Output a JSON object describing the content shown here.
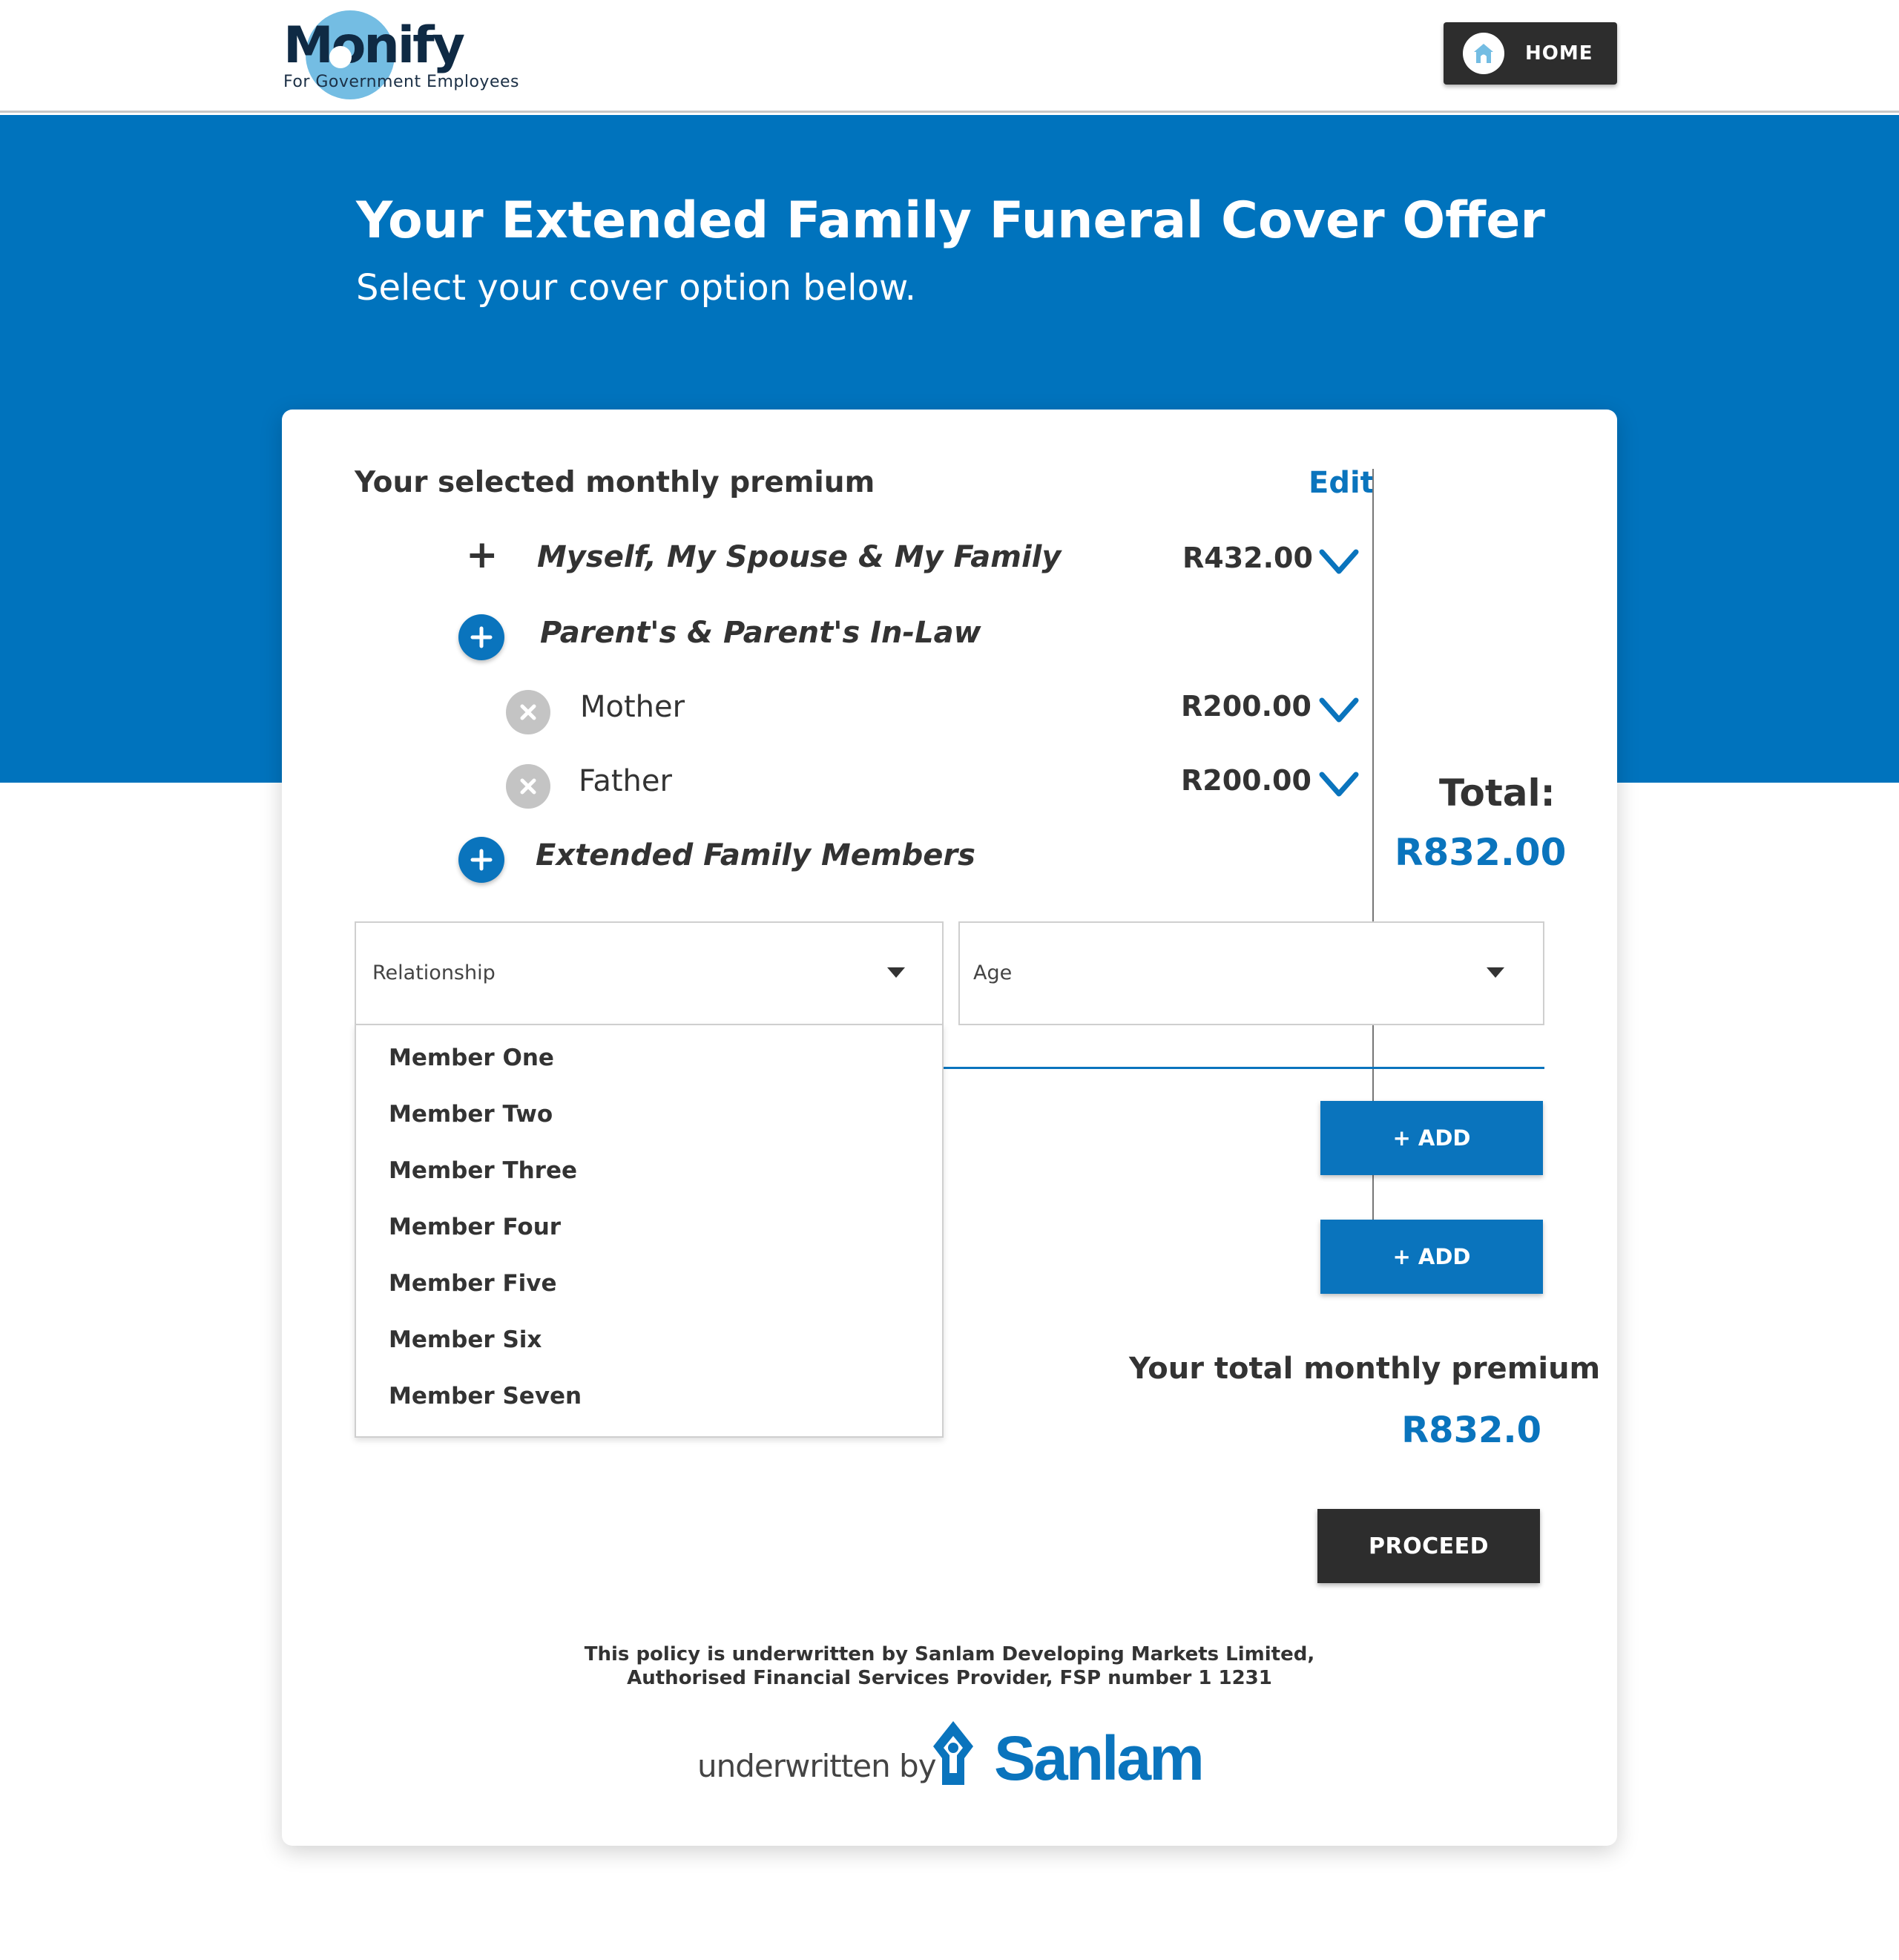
{
  "header": {
    "logo_text": "Monify",
    "logo_tagline": "For Government Employees",
    "home_button_label": "HOME",
    "home_icon": "home-icon"
  },
  "hero": {
    "title": "Your Extended Family Funeral Cover Offer",
    "subtitle": "Select your cover option below."
  },
  "premium_summary": {
    "title": "Your selected monthly premium",
    "edit_label": "Edit",
    "rows": [
      {
        "label": "Myself, My Spouse & My Family",
        "price": "R432.00",
        "icon": "plus-icon"
      },
      {
        "label": "Parent's & Parent's In-Law",
        "icon": "add-circle-icon"
      },
      {
        "label": "Mother",
        "price": "R200.00",
        "icon": "remove-circle-icon"
      },
      {
        "label": "Father",
        "price": "R200.00",
        "icon": "remove-circle-icon"
      },
      {
        "label": "Extended Family Members",
        "icon": "add-circle-icon"
      }
    ],
    "total_label": "Total:",
    "total_value": "R832.00"
  },
  "extended_form": {
    "relationship_placeholder": "Relationship",
    "age_placeholder": "Age",
    "relationship_options": [
      "Member One",
      "Member Two",
      "Member Three",
      "Member Four",
      "Member Five",
      "Member Six",
      "Member Seven"
    ],
    "add_buttons": [
      "+ ADD",
      "+ ADD"
    ]
  },
  "totals": {
    "label": "Your total monthly premium",
    "value": "R832.0"
  },
  "proceed_label": "PROCEED",
  "footer": {
    "disclaimer_line1": "This policy is underwritten by Sanlam Developing Markets Limited,",
    "disclaimer_line2": "Authorised Financial Services Provider, FSP number 1 1231",
    "underwritten_by": "underwritten by",
    "brand": "Sanlam"
  },
  "colors": {
    "primary_blue": "#0a74bd",
    "hero_blue": "#0073bd",
    "dark_button": "#2d2d2d",
    "logo_accent": "#74bde3"
  }
}
